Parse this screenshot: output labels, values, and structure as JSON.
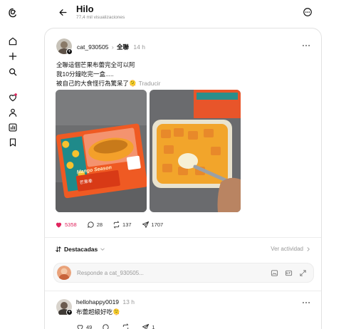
{
  "header": {
    "title": "Hilo",
    "views": "77,4 mil visualizaciones"
  },
  "sidebar": {
    "items": [
      {
        "icon": "threads-logo-icon"
      },
      {
        "icon": "home-icon"
      },
      {
        "icon": "create-plus-icon"
      },
      {
        "icon": "search-icon"
      },
      {
        "icon": "activity-heart-icon"
      },
      {
        "icon": "profile-icon"
      },
      {
        "icon": "insights-icon"
      },
      {
        "icon": "saved-icon"
      }
    ]
  },
  "post": {
    "username": "cat_930505",
    "community": "全聯",
    "time": "14 h",
    "lines": [
      "全聯這個芒果布蕾完全可以阿",
      "我10分鐘吃完一盒.....",
      "被自己的大食怪行為驚呆了🫠"
    ],
    "translate": "Traducir",
    "image_labels": {
      "package_title": "Mango Season",
      "package_sub": "芒果季"
    },
    "stats": {
      "likes": "5358",
      "comments": "28",
      "reposts": "137",
      "shares": "1707"
    }
  },
  "replies_bar": {
    "sort_label": "Destacadas",
    "activity_label": "Ver actividad"
  },
  "reply_input": {
    "placeholder": "Responde a cat_930505..."
  },
  "comment": {
    "username": "hellohappy0019",
    "time": "13 h",
    "text": "布蕾超級好吃🫠",
    "likes": "49",
    "shares": "1"
  },
  "colors": {
    "like_red": "#e0245e",
    "muted": "#999999",
    "border": "#e2e2e2"
  }
}
